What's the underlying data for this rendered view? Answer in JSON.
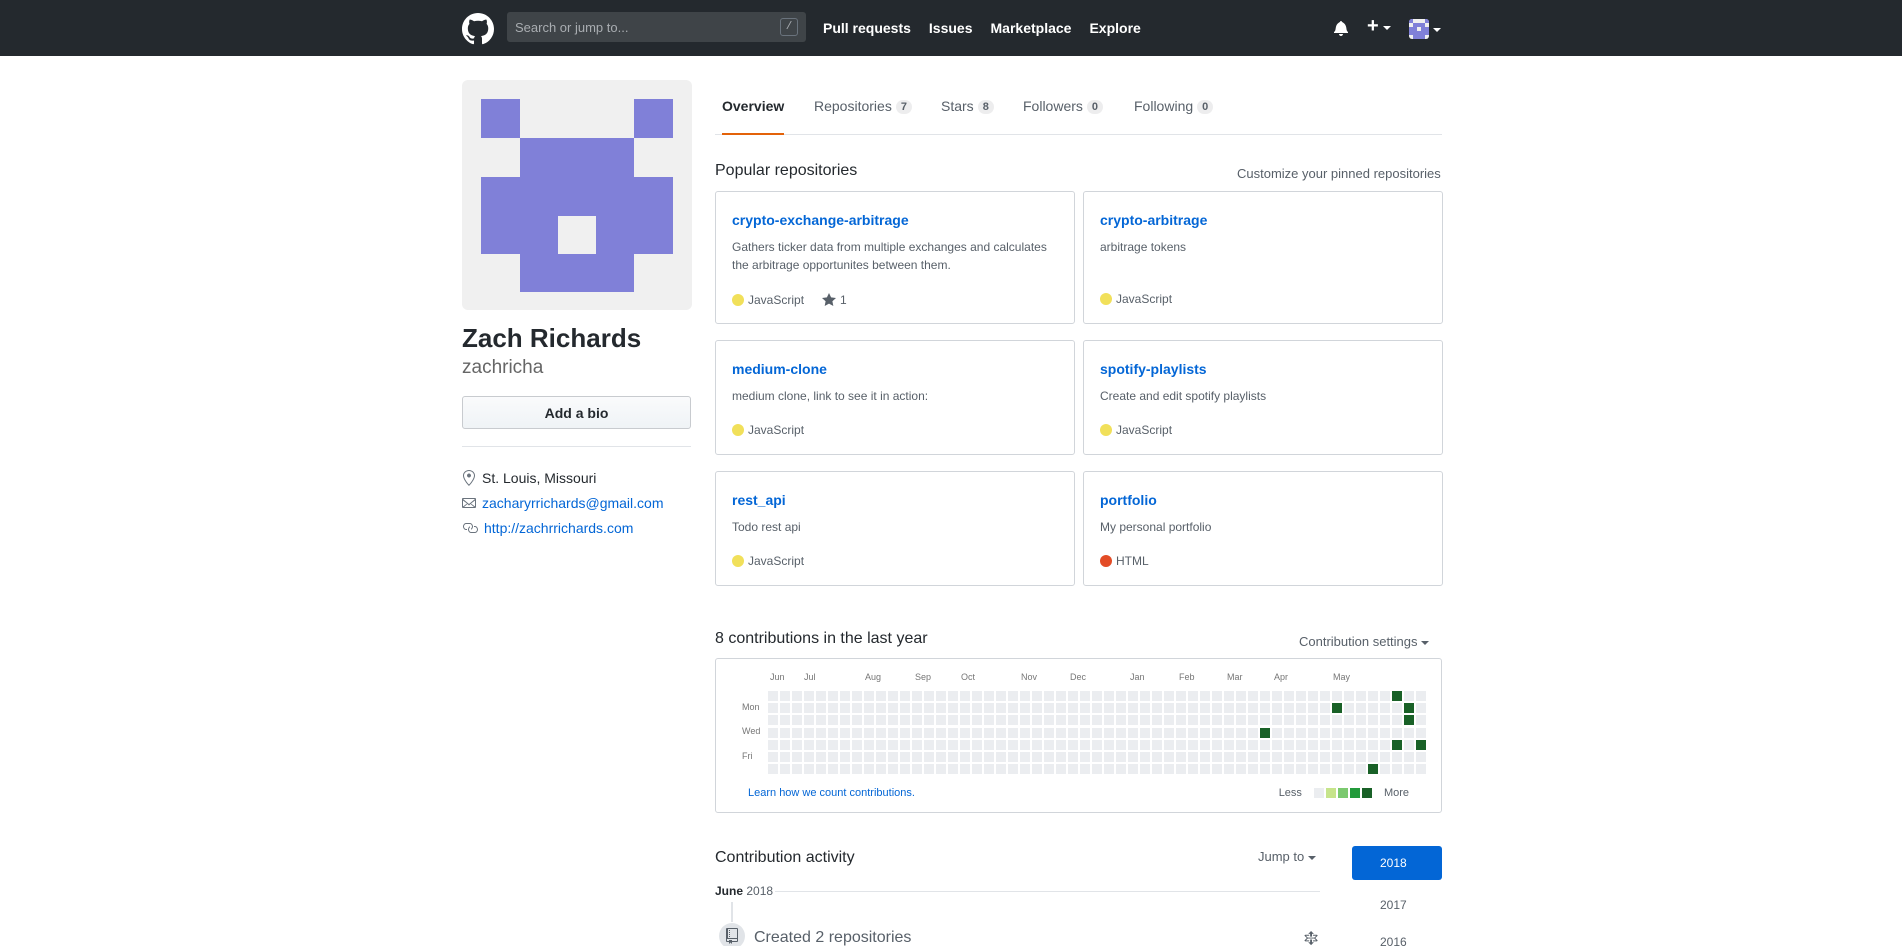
{
  "header": {
    "search_placeholder": "Search or jump to...",
    "search_shortcut": "/",
    "nav": [
      "Pull requests",
      "Issues",
      "Marketplace",
      "Explore"
    ]
  },
  "profile": {
    "name": "Zach Richards",
    "username": "zachricha",
    "bio_button": "Add a bio",
    "location": "St. Louis, Missouri",
    "email": "zacharyrrichards@gmail.com",
    "website": "http://zachrrichards.com"
  },
  "tabs": [
    {
      "label": "Overview",
      "count": ""
    },
    {
      "label": "Repositories",
      "count": "7"
    },
    {
      "label": "Stars",
      "count": "8"
    },
    {
      "label": "Followers",
      "count": "0"
    },
    {
      "label": "Following",
      "count": "0"
    }
  ],
  "pinned": {
    "title": "Popular repositories",
    "customize": "Customize your pinned repositories",
    "repos": [
      {
        "name": "crypto-exchange-arbitrage",
        "desc": "Gathers ticker data from multiple exchanges and calculates the arbitrage opportunites between them.",
        "lang": "JavaScript",
        "lang_color": "#f1e05a",
        "stars": "1"
      },
      {
        "name": "crypto-arbitrage",
        "desc": "arbitrage tokens",
        "lang": "JavaScript",
        "lang_color": "#f1e05a",
        "stars": ""
      },
      {
        "name": "medium-clone",
        "desc": "medium clone, link to see it in action:",
        "lang": "JavaScript",
        "lang_color": "#f1e05a",
        "stars": ""
      },
      {
        "name": "spotify-playlists",
        "desc": "Create and edit spotify playlists",
        "lang": "JavaScript",
        "lang_color": "#f1e05a",
        "stars": ""
      },
      {
        "name": "rest_api",
        "desc": "Todo rest api",
        "lang": "JavaScript",
        "lang_color": "#f1e05a",
        "stars": ""
      },
      {
        "name": "portfolio",
        "desc": "My personal portfolio",
        "lang": "HTML",
        "lang_color": "#e34c26",
        "stars": ""
      }
    ]
  },
  "contributions": {
    "title": "8 contributions in the last year",
    "settings": "Contribution settings",
    "months": [
      "Jun",
      "Jul",
      "Aug",
      "Sep",
      "Oct",
      "Nov",
      "Dec",
      "Jan",
      "Feb",
      "Mar",
      "Apr",
      "May"
    ],
    "days": [
      "Mon",
      "Wed",
      "Fri"
    ],
    "learn": "Learn how we count contributions.",
    "less": "Less",
    "more": "More",
    "active_cells": [
      [
        41,
        3
      ],
      [
        47,
        1
      ],
      [
        50,
        6
      ],
      [
        52,
        0
      ],
      [
        52,
        4
      ],
      [
        53,
        1
      ],
      [
        53,
        2
      ],
      [
        54,
        4
      ]
    ],
    "colors": [
      "#ebedf0",
      "#c6e48b",
      "#7bc96f",
      "#239a3b",
      "#196127"
    ]
  },
  "activity": {
    "title": "Contribution activity",
    "jump": "Jump to",
    "years": [
      "2018",
      "2017",
      "2016"
    ],
    "month": "June",
    "month_year": "2018",
    "event": "Created 2 repositories"
  }
}
